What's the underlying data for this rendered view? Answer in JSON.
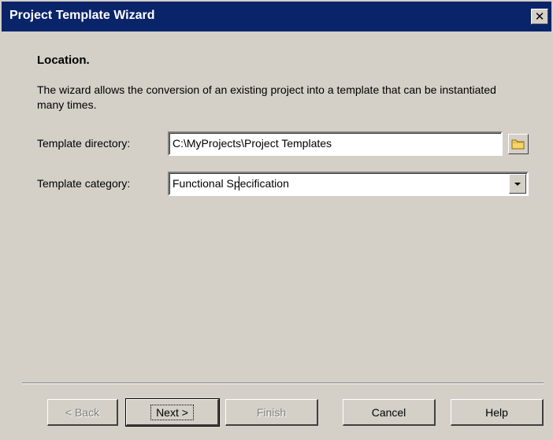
{
  "window": {
    "title": "Project Template Wizard",
    "close_symbol": "✕"
  },
  "page": {
    "heading": "Location.",
    "description": "The wizard allows the conversion of an existing project into a template that can be instantiated many times."
  },
  "form": {
    "directory_label": "Template directory:",
    "directory_value": "C:\\MyProjects\\Project Templates",
    "category_label": "Template category:",
    "category_value": "Functional Specification"
  },
  "buttons": {
    "back": "< Back",
    "next": "Next >",
    "finish": "Finish",
    "cancel": "Cancel",
    "help": "Help"
  },
  "icons": {
    "browse": "folder-icon",
    "dropdown": "chevron-down-icon",
    "close": "close-icon"
  },
  "colors": {
    "titlebar": "#0a246a",
    "face": "#d4d0c8"
  }
}
